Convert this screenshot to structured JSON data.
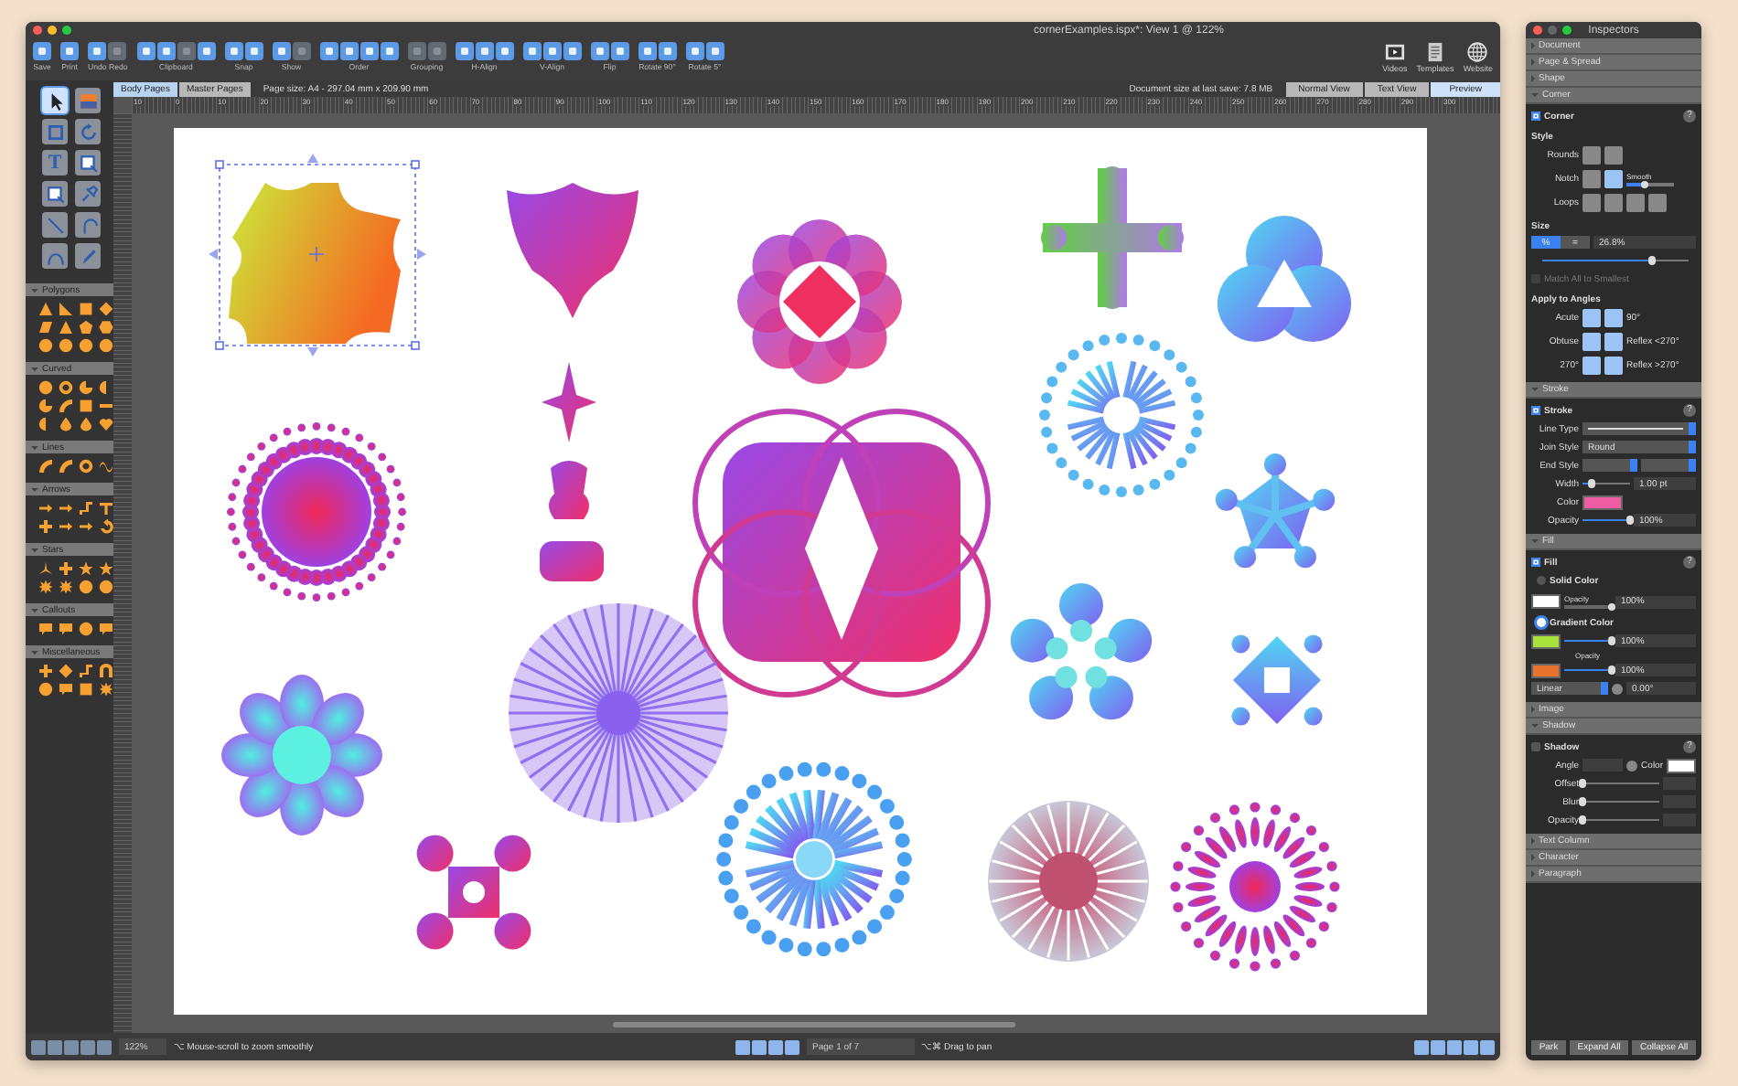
{
  "window": {
    "title": "cornerExamples.ispx*: View 1 @ 122%"
  },
  "toolbar": {
    "groups": [
      {
        "label": "Save",
        "icons": [
          {
            "disabled": false
          }
        ]
      },
      {
        "label": "Print",
        "icons": [
          {
            "disabled": false
          }
        ]
      },
      {
        "label": "Undo Redo",
        "icons": [
          {
            "disabled": false
          },
          {
            "disabled": true
          }
        ]
      },
      {
        "label": "Clipboard",
        "icons": [
          {
            "disabled": false
          },
          {
            "disabled": false
          },
          {
            "disabled": true
          },
          {
            "disabled": false
          }
        ]
      },
      {
        "label": "Snap",
        "icons": [
          {
            "disabled": false
          },
          {
            "disabled": false
          }
        ]
      },
      {
        "label": "Show",
        "icons": [
          {
            "disabled": false
          },
          {
            "disabled": true
          }
        ]
      },
      {
        "label": "Order",
        "icons": [
          {
            "disabled": false
          },
          {
            "disabled": false
          },
          {
            "disabled": false
          },
          {
            "disabled": false
          }
        ]
      },
      {
        "label": "Grouping",
        "icons": [
          {
            "disabled": true
          },
          {
            "disabled": true
          }
        ]
      },
      {
        "label": "H-Align",
        "icons": [
          {
            "disabled": false
          },
          {
            "disabled": false
          },
          {
            "disabled": false
          }
        ]
      },
      {
        "label": "V-Align",
        "icons": [
          {
            "disabled": false
          },
          {
            "disabled": false
          },
          {
            "disabled": false
          }
        ]
      },
      {
        "label": "Flip",
        "icons": [
          {
            "disabled": false
          },
          {
            "disabled": false
          }
        ]
      },
      {
        "label": "Rotate 90°",
        "icons": [
          {
            "disabled": false
          },
          {
            "disabled": false
          }
        ]
      },
      {
        "label": "Rotate 5°",
        "icons": [
          {
            "disabled": false
          },
          {
            "disabled": false
          }
        ]
      }
    ],
    "links": [
      {
        "label": "Videos",
        "kind": "film"
      },
      {
        "label": "Templates",
        "kind": "document"
      },
      {
        "label": "Website",
        "kind": "globe"
      }
    ]
  },
  "page_tabs": [
    {
      "label": "Body Pages",
      "selected": true
    },
    {
      "label": "Master Pages",
      "selected": false
    }
  ],
  "page_size": "Page size:  A4 - 297.04 mm x 209.90 mm",
  "document_size": "Document size at last save:  7.8 MB",
  "view_tabs": [
    {
      "label": "Normal View",
      "selected": false
    },
    {
      "label": "Text View",
      "selected": false
    },
    {
      "label": "Preview",
      "selected": true
    }
  ],
  "ruler": [
    "10",
    "0",
    "10",
    "20",
    "30",
    "40",
    "50",
    "60",
    "70",
    "80",
    "90",
    "100",
    "110",
    "120",
    "130",
    "140",
    "150",
    "160",
    "170",
    "180",
    "190",
    "200",
    "210",
    "220",
    "230",
    "240",
    "250",
    "260",
    "270",
    "280",
    "290",
    "300"
  ],
  "tools": [
    {
      "kind": "pointer",
      "selected": true
    },
    {
      "kind": "image",
      "selected": false
    },
    {
      "kind": "crop",
      "selected": false
    },
    {
      "kind": "rotate",
      "selected": false
    },
    {
      "kind": "text",
      "glyph": "T",
      "selected": false
    },
    {
      "kind": "frame",
      "selected": false
    },
    {
      "kind": "frame",
      "selected": false
    },
    {
      "kind": "pin",
      "selected": false
    },
    {
      "kind": "line",
      "selected": false
    },
    {
      "kind": "arc",
      "selected": false
    },
    {
      "kind": "curve",
      "selected": false
    },
    {
      "kind": "pen",
      "selected": false
    }
  ],
  "shape_sections": [
    {
      "label": "Polygons",
      "shapes": [
        {
          "kind": "triangle"
        },
        {
          "kind": "right-triangle"
        },
        {
          "kind": "square"
        },
        {
          "kind": "diamond"
        },
        {
          "kind": "parallelogram"
        },
        {
          "kind": "triangle"
        },
        {
          "kind": "pentagon"
        },
        {
          "kind": "hexagon"
        },
        {
          "kind": "circle"
        },
        {
          "kind": "circle"
        },
        {
          "kind": "circle"
        },
        {
          "kind": "circle"
        }
      ]
    },
    {
      "label": "Curved",
      "shapes": [
        {
          "kind": "circle"
        },
        {
          "kind": "ring"
        },
        {
          "kind": "pie"
        },
        {
          "kind": "half"
        },
        {
          "kind": "pie"
        },
        {
          "kind": "arc"
        },
        {
          "kind": "square"
        },
        {
          "kind": "bar"
        },
        {
          "kind": "half"
        },
        {
          "kind": "drop"
        },
        {
          "kind": "drop"
        },
        {
          "kind": "heart"
        }
      ]
    },
    {
      "label": "Lines",
      "shapes": [
        {
          "kind": "arc"
        },
        {
          "kind": "arc"
        },
        {
          "kind": "ring"
        },
        {
          "kind": "wave"
        }
      ]
    },
    {
      "label": "Arrows",
      "shapes": [
        {
          "kind": "arrow"
        },
        {
          "kind": "arrow"
        },
        {
          "kind": "elbow"
        },
        {
          "kind": "tee"
        },
        {
          "kind": "plus"
        },
        {
          "kind": "arrow"
        },
        {
          "kind": "arrow"
        },
        {
          "kind": "turn"
        }
      ]
    },
    {
      "label": "Stars",
      "shapes": [
        {
          "kind": "tristar"
        },
        {
          "kind": "plus"
        },
        {
          "kind": "star"
        },
        {
          "kind": "star"
        },
        {
          "kind": "burst"
        },
        {
          "kind": "burst"
        },
        {
          "kind": "circle"
        },
        {
          "kind": "circle"
        }
      ]
    },
    {
      "label": "Callouts",
      "shapes": [
        {
          "kind": "callout"
        },
        {
          "kind": "callout"
        },
        {
          "kind": "circle"
        },
        {
          "kind": "callout"
        }
      ]
    },
    {
      "label": "Miscellaneous",
      "shapes": [
        {
          "kind": "plus"
        },
        {
          "kind": "diamond"
        },
        {
          "kind": "elbow"
        },
        {
          "kind": "arch"
        },
        {
          "kind": "circle"
        },
        {
          "kind": "callout"
        },
        {
          "kind": "square"
        },
        {
          "kind": "burst"
        }
      ]
    }
  ],
  "status": {
    "zoom": "122%",
    "zoom_hint": "⌥ Mouse-scroll to zoom smoothly",
    "page": "Page 1 of 7",
    "pan_hint": "⌥⌘ Drag to pan"
  },
  "inspector": {
    "title": "Inspectors",
    "sections": [
      {
        "label": "Document",
        "expanded": false
      },
      {
        "label": "Page & Spread",
        "expanded": false
      },
      {
        "label": "Shape",
        "expanded": false
      },
      {
        "label": "Corner",
        "expanded": true,
        "kind": "corner",
        "panel": {
          "label": "Corner",
          "checked": true,
          "help": "?",
          "style_heading": "Style",
          "rounds_label": "Rounds",
          "notch_label": "Notch",
          "smooth_label": "Smooth",
          "smooth": {
            "level": 0.4
          },
          "loops_label": "Loops",
          "size_heading": "Size",
          "units": [
            {
              "label": "%",
              "selected": true
            },
            {
              "label": "=",
              "selected": false
            }
          ],
          "size_value": "26.8%",
          "size": {
            "level": 0.75
          },
          "match": {
            "label": "Match All to Smallest",
            "checked": false,
            "disabled": true
          },
          "angles_heading": "Apply to Angles",
          "angles": [
            {
              "label": "Acute",
              "note": "90°"
            },
            {
              "label": "Obtuse",
              "note": "Reflex <270°"
            },
            {
              "label": "270°",
              "note": "Reflex >270°"
            }
          ]
        }
      },
      {
        "label": "Stroke",
        "expanded": true,
        "kind": "stroke",
        "panel": {
          "label": "Stroke",
          "checked": true,
          "help": "?",
          "line_type_label": "Line Type",
          "join_label": "Join Style",
          "join_value": "Round",
          "end_label": "End Style",
          "width_label": "Width",
          "width": {
            "level": 0.2,
            "value": "1.00 pt"
          },
          "color_label": "Color",
          "color": "#ee5d9f",
          "opacity_label": "Opacity",
          "opacity": {
            "level": 1,
            "value": "100%"
          }
        }
      },
      {
        "label": "Fill",
        "expanded": true,
        "kind": "fill",
        "panel": {
          "label": "Fill",
          "checked": true,
          "help": "?",
          "solid": {
            "label": "Solid Color",
            "selected": false,
            "color": "#ffffff",
            "opacity_label": "Opacity",
            "level": 1,
            "value": "100%"
          },
          "gradient": {
            "label": "Gradient Color",
            "selected": true,
            "opacity_label": "Opacity",
            "stops": [
              {
                "color": "#a8e23c",
                "level": 1,
                "value": "100%"
              },
              {
                "color": "#e8732e",
                "level": 1,
                "value": "100%"
              }
            ],
            "type": "Linear",
            "angle": "0.00°"
          }
        }
      },
      {
        "label": "Image",
        "expanded": false
      },
      {
        "label": "Shadow",
        "expanded": true,
        "kind": "shadow",
        "panel": {
          "label": "Shadow",
          "checked": false,
          "help": "?",
          "angle_label": "Angle",
          "color_label": "Color",
          "color": "#ffffff",
          "rows": [
            {
              "label": "Offset",
              "level": 0
            },
            {
              "label": "Blur",
              "level": 0
            },
            {
              "label": "Opacity",
              "level": 0
            }
          ]
        }
      },
      {
        "label": "Text Column",
        "expanded": false
      },
      {
        "label": "Character",
        "expanded": false
      },
      {
        "label": "Paragraph",
        "expanded": false
      }
    ],
    "buttons": [
      "Park",
      "Expand All",
      "Collapse All"
    ]
  }
}
